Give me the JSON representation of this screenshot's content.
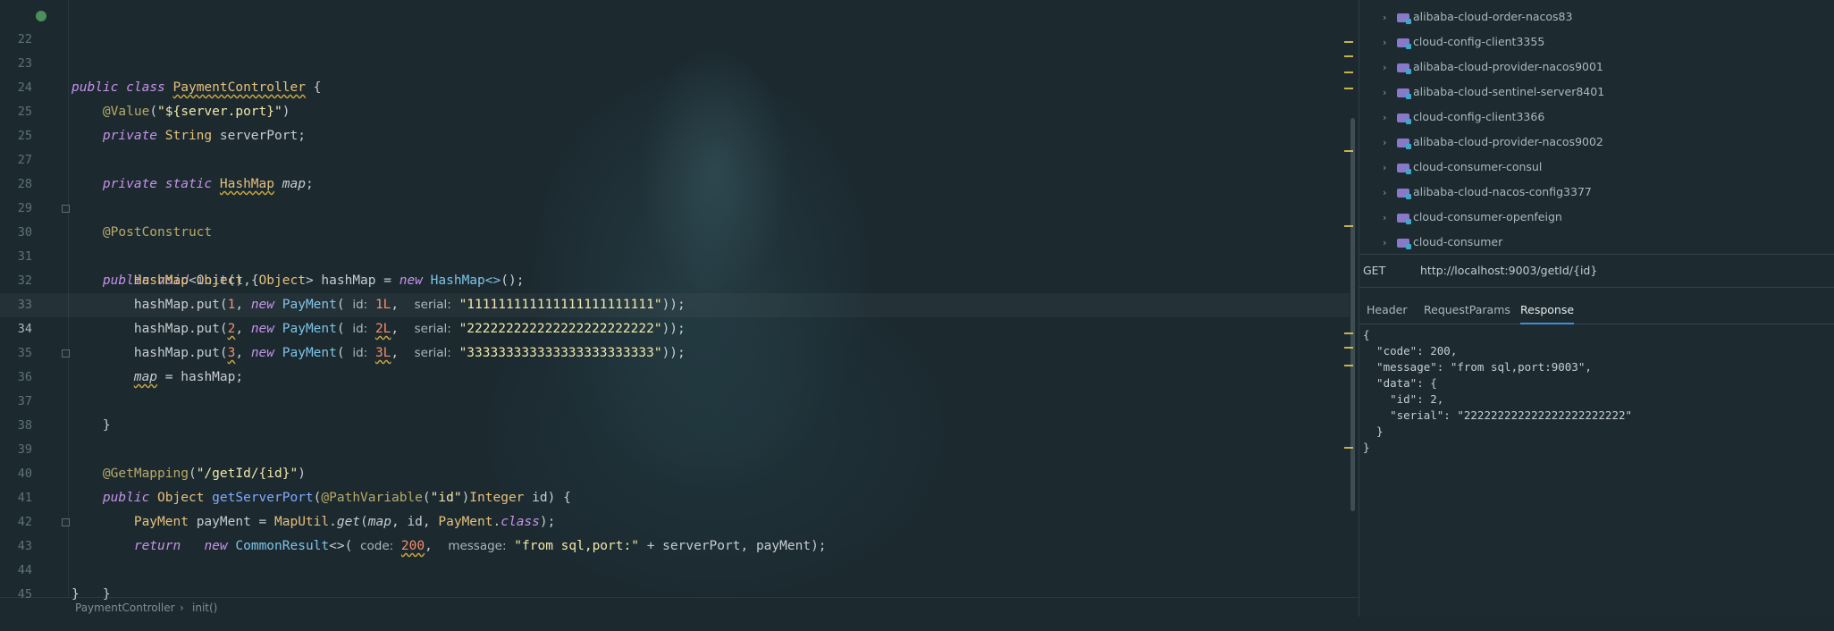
{
  "editor": {
    "lines": [
      {
        "n": "22"
      },
      {
        "n": "23"
      },
      {
        "n": "24"
      },
      {
        "n": "25"
      },
      {
        "n": "27"
      },
      {
        "n": "28"
      },
      {
        "n": "29"
      },
      {
        "n": "30"
      },
      {
        "n": "31"
      },
      {
        "n": "32"
      },
      {
        "n": "33"
      },
      {
        "n": "34"
      },
      {
        "n": "35"
      },
      {
        "n": "36"
      },
      {
        "n": "37"
      },
      {
        "n": "38"
      },
      {
        "n": "39"
      },
      {
        "n": "40"
      },
      {
        "n": "41"
      },
      {
        "n": "42"
      },
      {
        "n": "43"
      },
      {
        "n": "44"
      },
      {
        "n": "45"
      }
    ],
    "tokens": {
      "public": "public",
      "class": "class",
      "private": "private",
      "static": "static",
      "void": "void",
      "new": "new",
      "return": "return",
      "PaymentController": "PaymentController",
      "Value": "@Value",
      "value_arg": "\"${server.port}\"",
      "String": "String",
      "serverPort": "serverPort",
      "HashMap": "HashMap",
      "map": "map",
      "PostConstruct": "@PostConstruct",
      "init": "init",
      "Object": "Object",
      "hashMap": "hashMap",
      "HashMapDiamond": "HashMap<>",
      "put": "put",
      "PayMent": "PayMent",
      "payMent": "payMent",
      "id_hint": "id:",
      "serial_hint": "serial:",
      "s1": "\"111111111111111111111111\"",
      "s2": "\"222222222222222222222222\"",
      "s3": "\"333333333333333333333333\"",
      "k1": "1",
      "k2": "2",
      "k3": "3",
      "l1": "1L",
      "l2": "2L",
      "l3": "3L",
      "GetMapping": "@GetMapping",
      "getmapping_arg": "\"/getId/{id}\"",
      "getServerPort": "getServerPort",
      "PathVariable": "@PathVariable",
      "pv_arg": "\"id\"",
      "Integer": "Integer",
      "id": "id",
      "MapUtil": "MapUtil",
      "get": "get",
      "PayMentClass": "PayMent",
      "class_kw": "class",
      "CommonResult": "CommonResult",
      "code_hint": "code:",
      "code_val": "200",
      "message_hint": "message:",
      "msg_val": "\"from sql,port:\""
    }
  },
  "breadcrumb": {
    "class": "PaymentController",
    "sep": "›",
    "method": "init()"
  },
  "project_tree": [
    "alibaba-cloud-order-nacos83",
    "cloud-config-client3355",
    "alibaba-cloud-provider-nacos9001",
    "alibaba-cloud-sentinel-server8401",
    "cloud-config-client3366",
    "alibaba-cloud-provider-nacos9002",
    "cloud-consumer-consul",
    "alibaba-cloud-nacos-config3377",
    "cloud-consumer-openfeign",
    "cloud-consumer"
  ],
  "request": {
    "method": "GET",
    "url": "http://localhost:9003/getId/{id}"
  },
  "tabs": [
    "Header",
    "RequestParams",
    "Response"
  ],
  "active_tab": "Response",
  "response_lines": [
    "{",
    "  \"code\": 200,",
    "  \"message\": \"from sql,port:9003\",",
    "  \"data\": {",
    "    \"id\": 2,",
    "    \"serial\": \"222222222222222222222222\"",
    "  }",
    "}"
  ],
  "colors": {
    "accent": "#3d8fd6",
    "folder": "#8a78c9",
    "keyword": "#c792ea",
    "type": "#e6c07b"
  }
}
